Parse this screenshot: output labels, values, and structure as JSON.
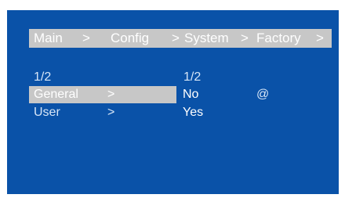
{
  "breadcrumb": {
    "items": [
      "Main",
      "Config",
      "System",
      "Factory"
    ],
    "separators": [
      ">",
      ">",
      ">",
      ">"
    ]
  },
  "left_panel": {
    "page_indicator": "1/2",
    "items": [
      {
        "label": "General",
        "arrow": ">",
        "selected": true
      },
      {
        "label": "User",
        "arrow": ">",
        "selected": false
      }
    ]
  },
  "right_panel": {
    "page_indicator": "1/2",
    "values": [
      "No",
      "Yes"
    ],
    "cursor_marker": "@"
  },
  "colors": {
    "screen_background": "#0a52a8",
    "highlight": "#c7c7c7",
    "text": "#ffffff"
  }
}
